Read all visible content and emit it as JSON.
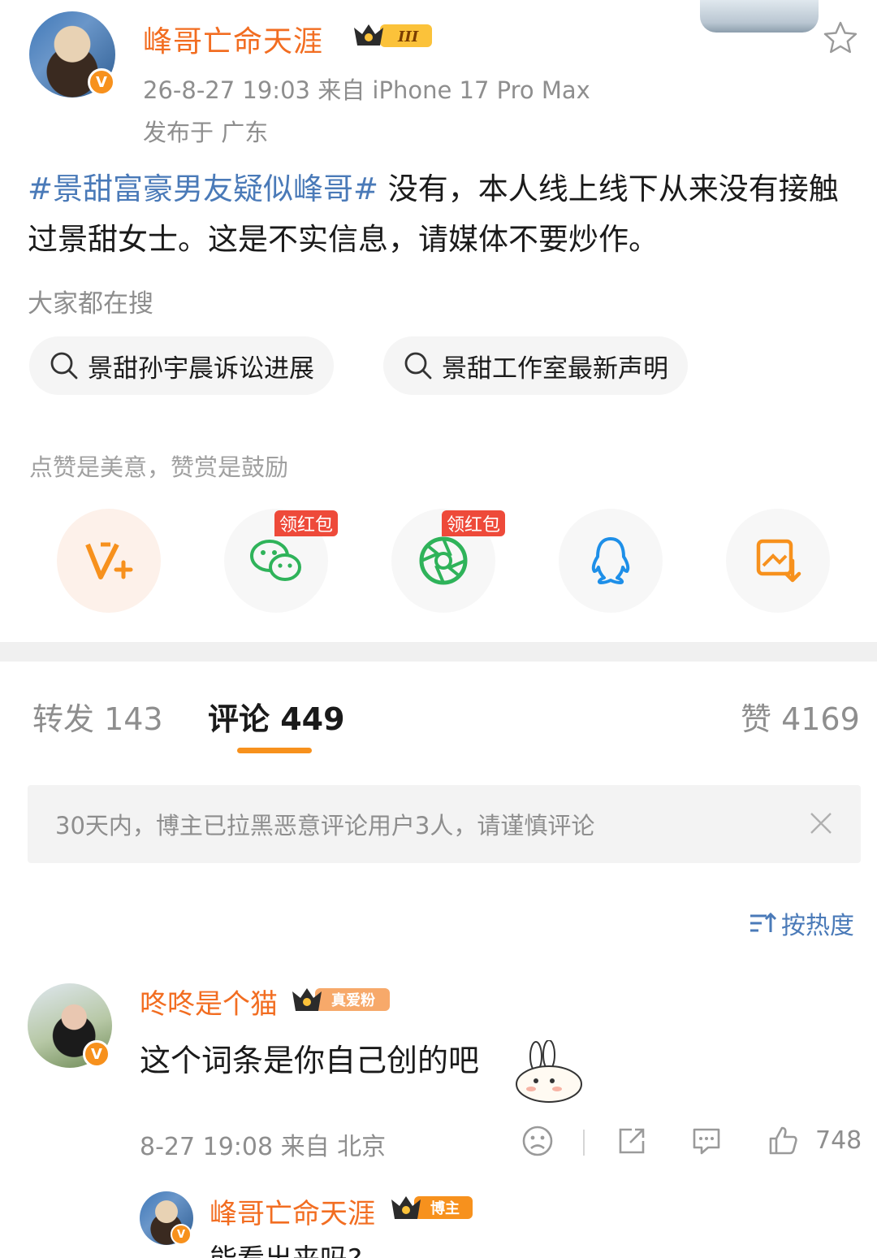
{
  "post": {
    "author": "峰哥亡命天涯",
    "level_badge": "III",
    "meta": "26-8-27 19:03  来自 iPhone 17 Pro Max",
    "location": "发布于 广东",
    "hashtag": "#景甜富豪男友疑似峰哥#",
    "body": " 没有，本人线上线下从来没有接触过景甜女士。这是不实信息，请媒体不要炒作。"
  },
  "search": {
    "label": "大家都在搜",
    "chips": [
      "景甜孙宇晨诉讼进展",
      "景甜工作室最新声明"
    ]
  },
  "reward": {
    "label": "点赞是美意，赞赏是鼓励",
    "redpack_label": "领红包",
    "share_icons": [
      "vplus-icon",
      "wechat-icon",
      "moments-icon",
      "qq-icon",
      "save-image-icon"
    ]
  },
  "tabs": {
    "repost": "转发 143",
    "comment": "评论 449",
    "like": "赞 4169"
  },
  "notice": "30天内，博主已拉黑恶意评论用户3人，请谨慎评论",
  "sort_label": "按热度",
  "comment": {
    "name": "咚咚是个猫",
    "badge": "真爱粉",
    "text": "这个词条是你自己创的吧",
    "meta": "8-27 19:08  来自 北京",
    "likes": "748"
  },
  "reply": {
    "name": "峰哥亡命天涯",
    "badge": "博主",
    "text": "能看出来吗?"
  },
  "colors": {
    "accent": "#f7911d",
    "name": "#f26d21",
    "link": "#4a7ab8",
    "muted": "#8e8e8e"
  }
}
